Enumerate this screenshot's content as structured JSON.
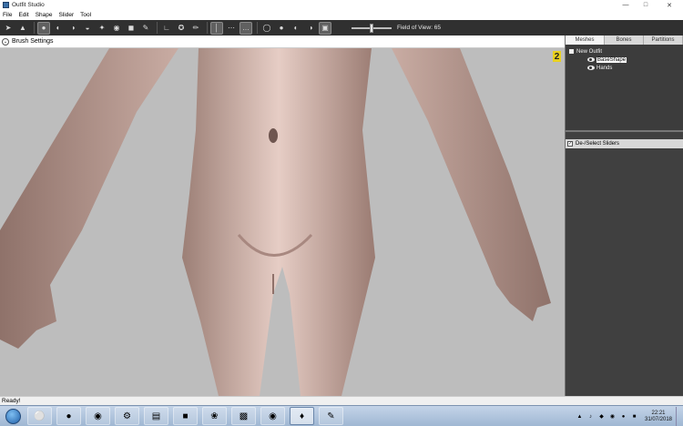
{
  "window": {
    "title": "Outfit Studio"
  },
  "menu": [
    "File",
    "Edit",
    "Shape",
    "Slider",
    "Tool"
  ],
  "toolbar": {
    "fov_label": "Field of View: 65",
    "fov_value": 65
  },
  "brush_settings": {
    "label": "Brush Settings"
  },
  "viewport": {
    "indicator": "2"
  },
  "panel": {
    "tabs": [
      "Meshes",
      "Bones",
      "Partitions"
    ],
    "tree": {
      "root": "New Outfit",
      "children": [
        "BaseShape",
        "Hands"
      ]
    },
    "sliders_header": "De-/Select Sliders"
  },
  "status": {
    "text": "Ready!"
  },
  "taskbar": {
    "time": "22:21",
    "date": "31/07/2018"
  }
}
